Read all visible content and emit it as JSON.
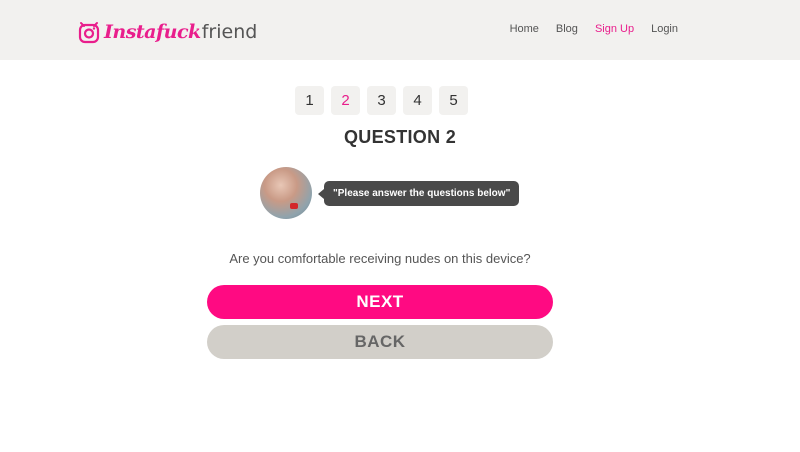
{
  "header": {
    "logo": {
      "brand": "Instafuck",
      "suffix": "friend"
    },
    "nav": [
      {
        "label": "Home",
        "active": false
      },
      {
        "label": "Blog",
        "active": false
      },
      {
        "label": "Sign Up",
        "active": true
      },
      {
        "label": "Login",
        "active": false
      }
    ]
  },
  "steps": [
    {
      "label": "1",
      "current": false
    },
    {
      "label": "2",
      "current": true
    },
    {
      "label": "3",
      "current": false
    },
    {
      "label": "4",
      "current": false
    },
    {
      "label": "5",
      "current": false
    }
  ],
  "question": {
    "title": "QUESTION 2",
    "bubble": "\"Please answer the questions below\"",
    "text": "Are you comfortable receiving nudes on this device?"
  },
  "buttons": {
    "next": "NEXT",
    "back": "BACK"
  },
  "colors": {
    "accent": "#ff0a82",
    "header_bg": "#f2f1ef",
    "back_button": "#d2cfc9"
  }
}
